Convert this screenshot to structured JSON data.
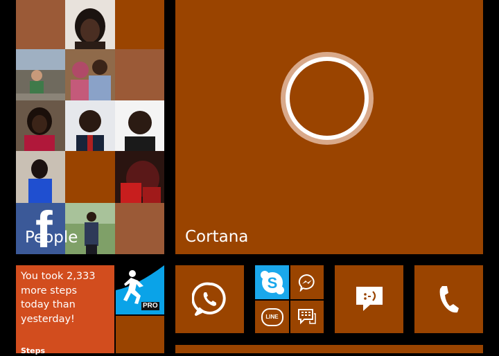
{
  "people_tile": {
    "label": "People",
    "brand_glyph": "f"
  },
  "cortana_tile": {
    "label": "Cortana"
  },
  "steps_tile": {
    "message": "You took 2,333 more steps today than yesterday!",
    "app_label": "Steps"
  },
  "runner_tile": {
    "badge": "PRO"
  },
  "messenger_group": {
    "line_label": "LINE"
  },
  "colors": {
    "accent": "#9a4400",
    "accent_light": "#9b5a37",
    "steps_bg": "#d24d1e",
    "skype_blue": "#1aa8ec",
    "runner_blue": "#0aa3e8",
    "facebook_blue": "#3b5998",
    "background": "#000000"
  },
  "icons": [
    "cortana-ring-icon",
    "whatsapp-icon",
    "skype-icon",
    "messenger-icon",
    "line-icon",
    "bbm-icon",
    "messaging-icon",
    "phone-icon",
    "runner-icon"
  ]
}
